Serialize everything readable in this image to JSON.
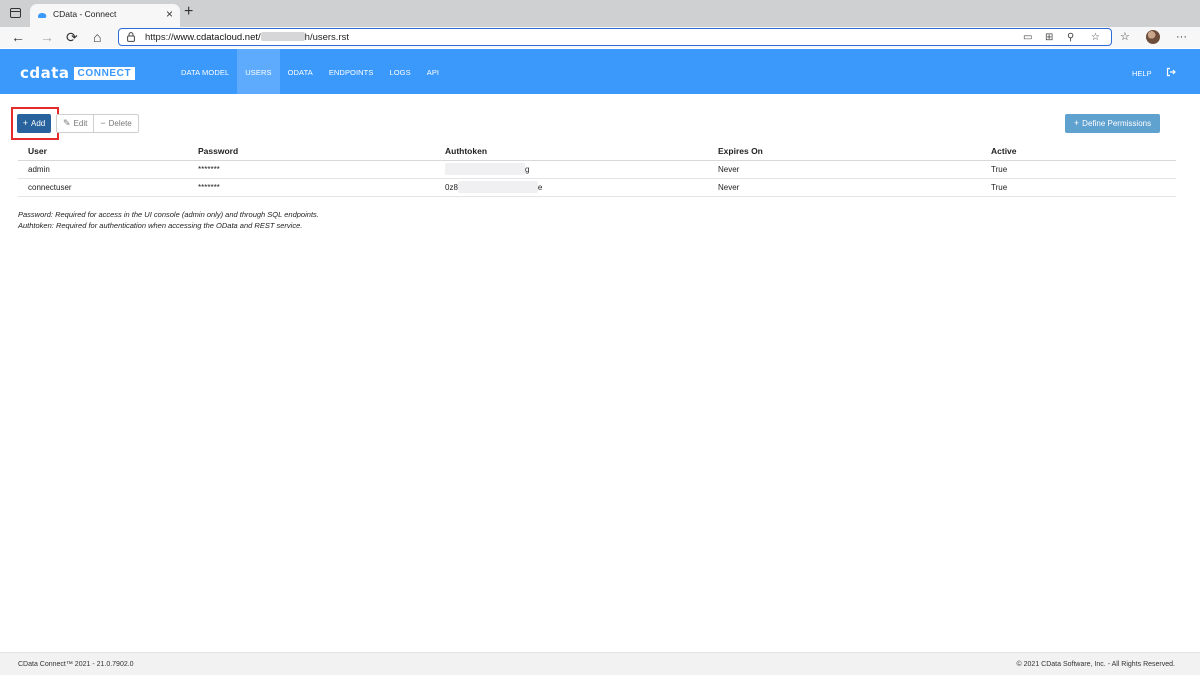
{
  "browser": {
    "tab_title": "CData - Connect",
    "tab_close": "×",
    "new_tab": "+",
    "url_prefix": "https://",
    "url_host": "www.cdatacloud.net/",
    "url_suffix": "h/users.rst",
    "nav_back": "←",
    "nav_forward": "→",
    "nav_reload": "⟳",
    "nav_home": "⌂",
    "more": "···"
  },
  "app": {
    "logo_text": "cdata",
    "logo_badge": "CONNECT",
    "nav": [
      {
        "label": "DATA MODEL",
        "active": false
      },
      {
        "label": "USERS",
        "active": true
      },
      {
        "label": "ODATA",
        "active": false
      },
      {
        "label": "ENDPOINTS",
        "active": false
      },
      {
        "label": "LOGS",
        "active": false
      },
      {
        "label": "API",
        "active": false
      }
    ],
    "help": "HELP",
    "accent": "#3b99fc"
  },
  "toolbar": {
    "add": "Add",
    "edit": "Edit",
    "delete": "Delete",
    "define_permissions": "Define Permissions"
  },
  "table": {
    "columns": [
      "User",
      "Password",
      "Authtoken",
      "Expires On",
      "Active"
    ],
    "rows": [
      {
        "user": "admin",
        "password": "*******",
        "token_start": "",
        "token_end": "g",
        "expires": "Never",
        "active": "True"
      },
      {
        "user": "connectuser",
        "password": "*******",
        "token_start": "0z8",
        "token_end": "e",
        "expires": "Never",
        "active": "True"
      }
    ]
  },
  "notes": [
    "Password: Required for access in the UI console (admin only) and through SQL endpoints.",
    "Authtoken: Required for authentication when accessing the OData and REST service."
  ],
  "footer": {
    "left": "CData Connect™ 2021 - 21.0.7902.0",
    "right": "© 2021 CData Software, Inc. - All Rights Reserved."
  }
}
